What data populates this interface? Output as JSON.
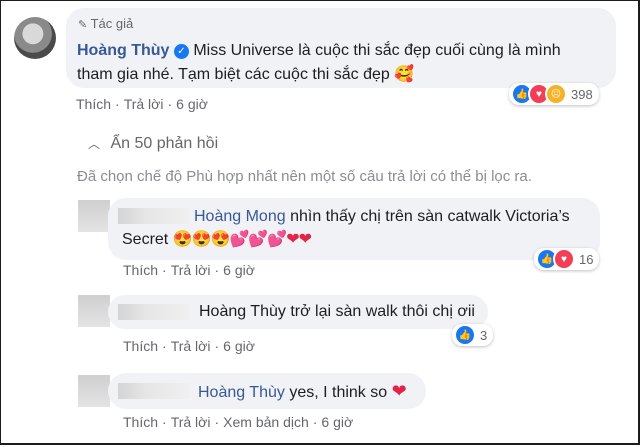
{
  "post": {
    "author_tag": "Tác giả",
    "author": "Hoàng Thùy",
    "text_line1": "Miss Universe là cuộc thi sắc đẹp cuối cùng là mình",
    "text_line2": "tham gia nhé. Tạm biệt các cuộc thi sắc đẹp",
    "emoji": "🥰",
    "reaction_count": "398",
    "actions": {
      "like": "Thích",
      "reply": "Trả lời",
      "time": "6 giờ"
    }
  },
  "toggle_replies": "Ẩn 50 phản hồi",
  "filter_notice": "Đã chọn chế độ Phù hợp nhất nên một số câu trả lời có thể bị lọc ra.",
  "replies": [
    {
      "name": "Hoàng Mong",
      "text_line1": "nhìn thấy chị trên sàn catwalk Victoria’s",
      "text_line2": "Secret",
      "emojis": "😍😍😍💕💕💕❤❤",
      "reaction_count": "16",
      "actions": {
        "like": "Thích",
        "reply": "Trả lời",
        "time": "6 giờ"
      }
    },
    {
      "text": "Hoàng Thùy trở lại sàn walk thôi chị ơii",
      "reaction_count": "3",
      "actions": {
        "like": "Thích",
        "reply": "Trả lời",
        "time": "6 giờ"
      }
    },
    {
      "name": "Hoàng Thùy",
      "text": "yes, I think so",
      "emoji": "❤",
      "actions": {
        "like": "Thích",
        "reply": "Trả lời",
        "translate": "Xem bản dịch",
        "time": "6 giờ"
      }
    }
  ],
  "colors": {
    "bubble": "#f0f2f5",
    "like_blue": "#1877f2",
    "love_red": "#f33e58",
    "name_blue": "#385898"
  }
}
